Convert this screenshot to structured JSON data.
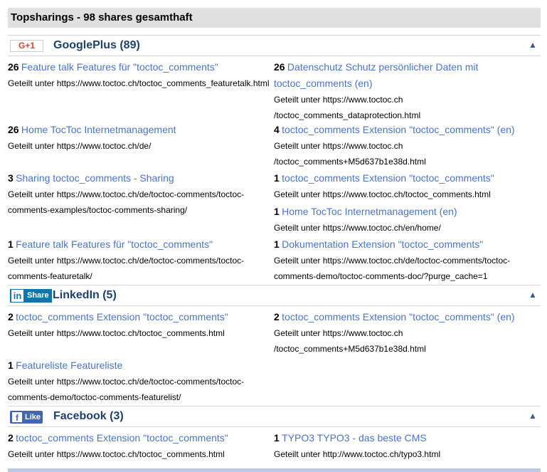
{
  "header": {
    "title": "Topsharings - 98 shares gesamthaft"
  },
  "sections": [
    {
      "id": "googleplus",
      "title": "GooglePlus (89)",
      "button_label": "G+1",
      "collapse_icon": "chevron-up-icon",
      "items": [
        {
          "count": "26",
          "title": "Feature talk Features für \"toctoc_comments\"",
          "url": "Geteilt unter https://www.toctoc.ch/toctoc_comments_featuretalk.html"
        },
        {
          "count": "26",
          "title": "Datenschutz Schutz persönlicher Daten mit toctoc_comments (en)",
          "url": "Geteilt unter https://www.toctoc.ch /toctoc_comments_dataprotection.html"
        },
        {
          "count": "26",
          "title": "Home TocToc Internetmanagement",
          "url": "Geteilt unter https://www.toctoc.ch/de/"
        },
        {
          "count": "4",
          "title": "toctoc_comments Extension \"toctoc_comments\" (en)",
          "url": "Geteilt unter https://www.toctoc.ch /toctoc_comments+M5d637b1e38d.html"
        },
        {
          "count": "3",
          "title": "Sharing toctoc_comments - Sharing",
          "url": "Geteilt unter https://www.toctoc.ch/de/toctoc-comments/toctoc-comments-examples/toctoc-comments-sharing/"
        },
        {
          "count": "1",
          "title": "toctoc_comments Extension \"toctoc_comments\"",
          "url": "Geteilt unter https://www.toctoc.ch/toctoc_comments.html"
        },
        {
          "count": "1",
          "title": "Home TocToc Internetmanagement (en)",
          "url": "Geteilt unter https://www.toctoc.ch/en/home/"
        },
        {
          "count": "1",
          "title": "Feature talk Features für \"toctoc_comments\"",
          "url": "Geteilt unter https://www.toctoc.ch/de/toctoc-comments/toctoc-comments-featuretalk/"
        },
        {
          "count": "1",
          "title": "Dokumentation Extension \"toctoc_comments\"",
          "url": "Geteilt unter https://www.toctoc.ch/de/toctoc-comments/toctoc-comments-demo/toctoc-comments-doc/?purge_cache=1"
        }
      ]
    },
    {
      "id": "linkedin",
      "title": "LinkedIn (5)",
      "button_logo": "in",
      "button_label": "Share",
      "collapse_icon": "chevron-up-icon",
      "items": [
        {
          "count": "2",
          "title": "toctoc_comments Extension \"toctoc_comments\"",
          "url": "Geteilt unter https://www.toctoc.ch/toctoc_comments.html"
        },
        {
          "count": "2",
          "title": "toctoc_comments Extension \"toctoc_comments\" (en)",
          "url": "Geteilt unter https://www.toctoc.ch /toctoc_comments+M5d637b1e38d.html"
        },
        {
          "count": "1",
          "title": "Featureliste Featureliste",
          "url": "Geteilt unter https://www.toctoc.ch/de/toctoc-comments/toctoc-comments-demo/toctoc-comments-featurelist/"
        }
      ]
    },
    {
      "id": "facebook",
      "title": "Facebook (3)",
      "button_logo": "f",
      "button_label": "Like",
      "collapse_icon": "chevron-up-icon",
      "items": [
        {
          "count": "2",
          "title": "toctoc_comments Extension \"toctoc_comments\"",
          "url": "Geteilt unter https://www.toctoc.ch/toctoc_comments.html"
        },
        {
          "count": "1",
          "title": "TYPO3 TYPO3 - das beste CMS",
          "url": "Geteilt unter http://www.toctoc.ch/typo3.html"
        }
      ]
    }
  ],
  "colors": {
    "link": "#4a73c6",
    "section_title": "#1f3f6e",
    "header_bg": "#e0e0e0",
    "linkedin": "#0e76a8",
    "facebook": "#4267b2",
    "googleplus": "#d9432f"
  }
}
